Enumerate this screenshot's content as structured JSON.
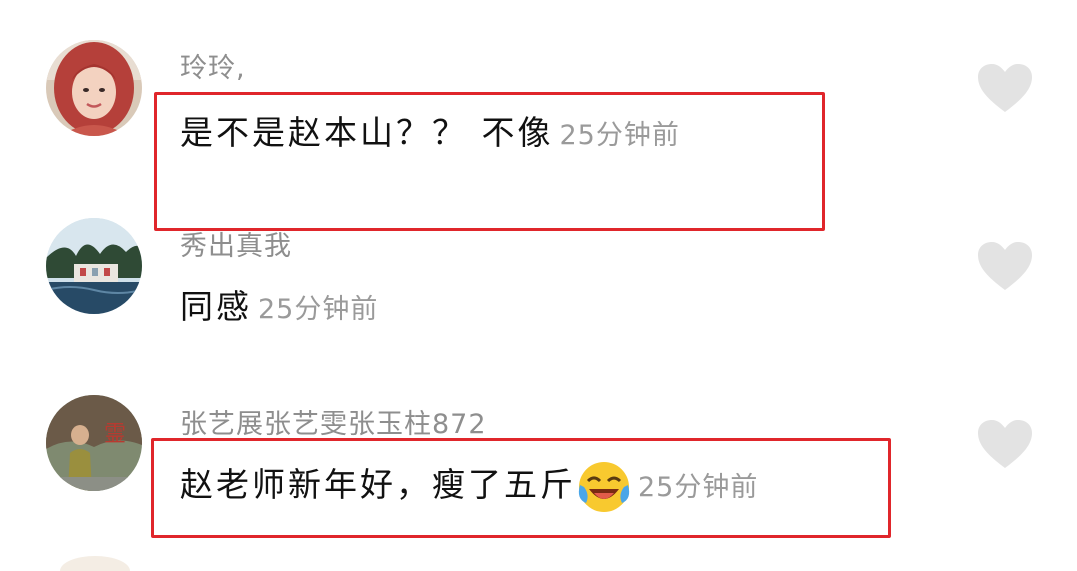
{
  "comments": [
    {
      "username": "玲玲,",
      "content": "是不是赵本山？？ 不像",
      "time": "25分钟前",
      "highlighted": true
    },
    {
      "username": "秀出真我",
      "content": "同感",
      "time": "25分钟前",
      "highlighted": false
    },
    {
      "username": "张艺展张艺雯张玉柱872",
      "content": "赵老师新年好，瘦了五斤",
      "time": "25分钟前",
      "highlighted": true,
      "emoji": "laughing-tears-emoji"
    }
  ],
  "colors": {
    "highlight_border": "#e0262b",
    "username": "#8e8e8e",
    "content": "#111111",
    "time": "#9a9a9a",
    "like_icon": "#e3e3e3"
  },
  "icons": [
    "heart-icon",
    "laughing-tears-emoji"
  ]
}
